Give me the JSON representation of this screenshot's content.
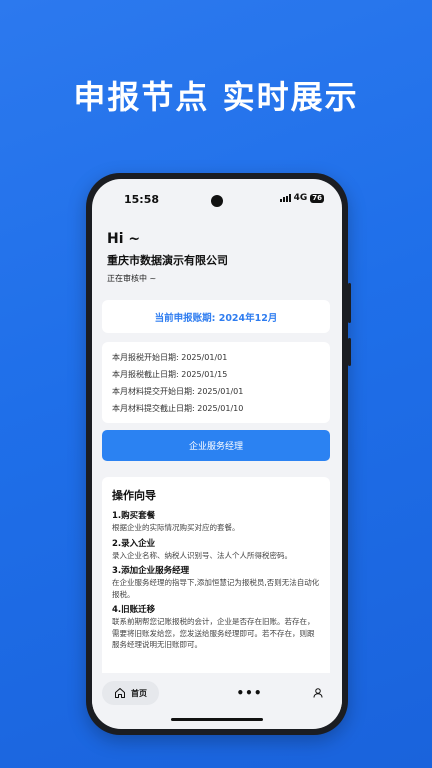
{
  "headline": "申报节点 实时展示",
  "status_bar": {
    "time": "15:58",
    "network": "4G",
    "battery": "76"
  },
  "greeting": "Hi ~",
  "company_name": "重庆市数据演示有限公司",
  "review_status": "正在审核中 ~",
  "period_label": "当前申报账期: 2024年12月",
  "dates": [
    "本月报税开始日期: 2025/01/01",
    "本月报税截止日期: 2025/01/15",
    "本月材料提交开始日期: 2025/01/01",
    "本月材料提交截止日期: 2025/01/10"
  ],
  "manager_button": "企业服务经理",
  "guide": {
    "title": "操作向导",
    "steps": [
      {
        "title": "1.购买套餐",
        "desc": "根据企业的实际情况购买对应的套餐。"
      },
      {
        "title": "2.录入企业",
        "desc": "录入企业名称、纳税人识别号、法人个人所得税密码。"
      },
      {
        "title": "3.添加企业服务经理",
        "desc": "在企业服务经理的指导下,添加恒慧记为报税员,否则无法自动化报税。"
      },
      {
        "title": "4.旧账迁移",
        "desc": "联系前期帮您记账报税的会计，企业是否存在旧账。若存在，需要将旧账发给您，您发送给服务经理即可。若不存在，则跟服务经理说明无旧账即可。"
      }
    ]
  },
  "tabbar": {
    "home": "首页",
    "more": "•••"
  },
  "colors": {
    "brand": "#2b82f2",
    "background": "#1f6fe9"
  }
}
